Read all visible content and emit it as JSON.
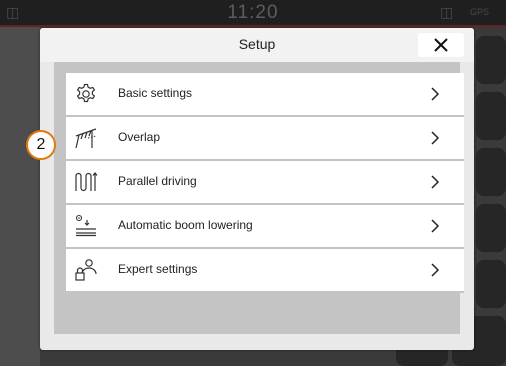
{
  "status_bar": {
    "clock": "11:20",
    "gps_label": "GPS"
  },
  "dialog": {
    "title": "Setup",
    "close_label": "close"
  },
  "menu": {
    "items": [
      {
        "label": "Basic settings",
        "icon": "gear-icon"
      },
      {
        "label": "Overlap",
        "icon": "overlap-icon"
      },
      {
        "label": "Parallel driving",
        "icon": "parallel-driving-icon"
      },
      {
        "label": "Automatic boom lowering",
        "icon": "boom-lowering-icon"
      },
      {
        "label": "Expert settings",
        "icon": "expert-user-lock-icon"
      }
    ]
  },
  "callout": {
    "number": "2",
    "color": "#e07a10"
  },
  "colors": {
    "accent_orange": "#e07a10",
    "status_red": "#6a2020",
    "dialog_bg": "#e9e9e9",
    "list_bg": "#c4c4c4"
  }
}
